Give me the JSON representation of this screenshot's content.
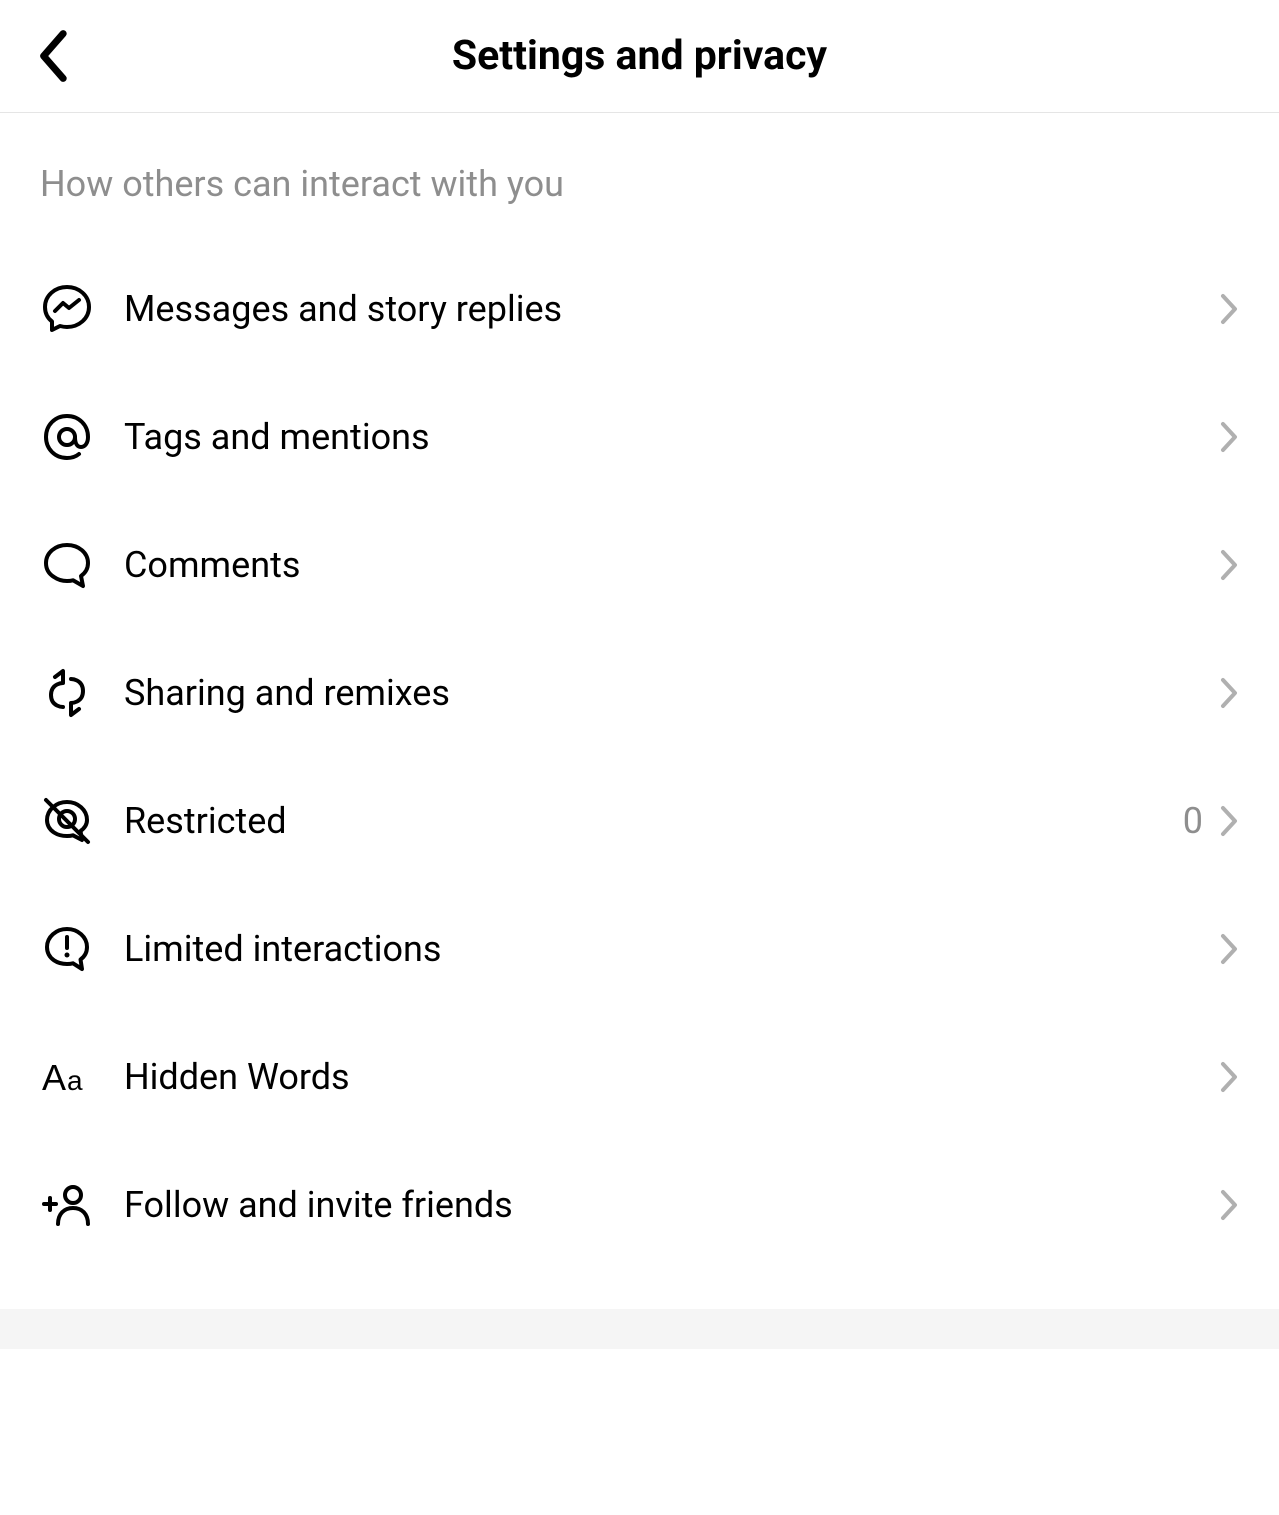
{
  "header": {
    "title": "Settings and privacy"
  },
  "section": {
    "header": "How others can interact with you",
    "items": [
      {
        "icon": "messenger-icon",
        "label": "Messages and story replies",
        "value": null
      },
      {
        "icon": "at-icon",
        "label": "Tags and mentions",
        "value": null
      },
      {
        "icon": "comment-icon",
        "label": "Comments",
        "value": null
      },
      {
        "icon": "share-icon",
        "label": "Sharing and remixes",
        "value": null
      },
      {
        "icon": "restricted-icon",
        "label": "Restricted",
        "value": "0"
      },
      {
        "icon": "limited-icon",
        "label": "Limited interactions",
        "value": null
      },
      {
        "icon": "aa-icon",
        "label": "Hidden Words",
        "value": null
      },
      {
        "icon": "follow-icon",
        "label": "Follow and invite friends",
        "value": null
      }
    ]
  }
}
